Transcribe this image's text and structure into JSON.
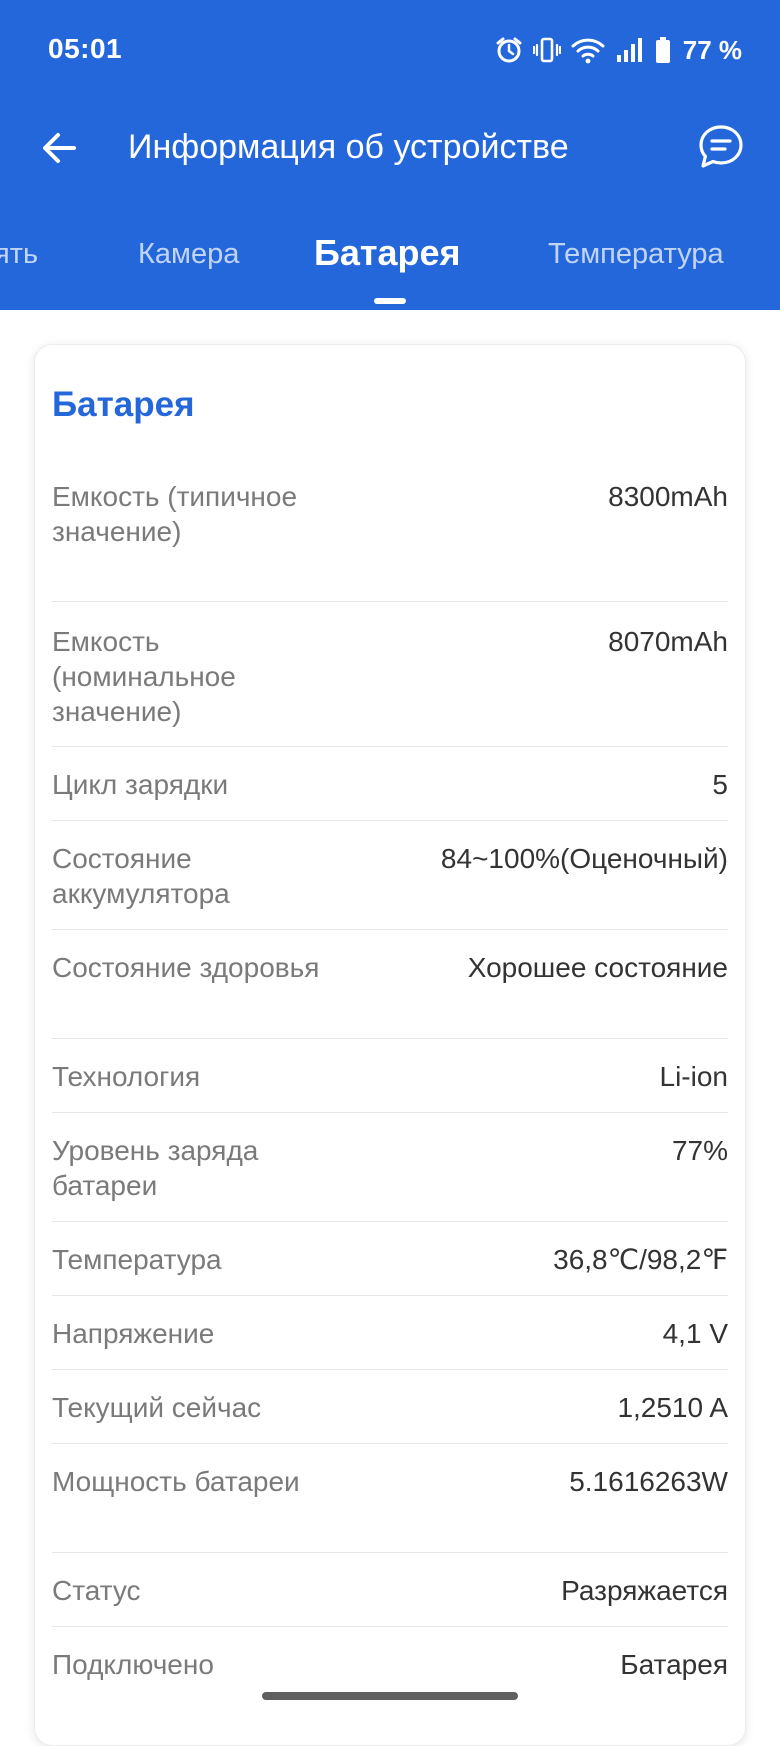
{
  "status_bar": {
    "time": "05:01",
    "battery_percent": "77 %",
    "icons": [
      "alarm-icon",
      "vibrate-icon",
      "wifi-icon",
      "signal-icon",
      "battery-icon"
    ]
  },
  "appbar": {
    "title": "Информация об устройстве",
    "back_icon": "arrow-left-icon",
    "chat_icon": "chat-bubble-icon"
  },
  "tabs": [
    {
      "label": "Память",
      "visible_text": "ять",
      "active": false
    },
    {
      "label": "Камера",
      "active": false
    },
    {
      "label": "Батарея",
      "active": true
    },
    {
      "label": "Температура",
      "active": false
    }
  ],
  "card": {
    "title": "Батарея",
    "rows": [
      {
        "label": "Емкость (типичное значение)",
        "value": "8300mAh"
      },
      {
        "label": "Емкость (номинальное значение)",
        "value": "8070mAh"
      },
      {
        "label": "Цикл зарядки",
        "value": "5"
      },
      {
        "label": "Состояние аккумулятора",
        "value": "84~100%(Оценочный)"
      },
      {
        "label": "Состояние здоровья",
        "value": "Хорошее состояние"
      },
      {
        "label": "Технология",
        "value": "Li-ion"
      },
      {
        "label": "Уровень заряда батареи",
        "value": "77%"
      },
      {
        "label": "Температура",
        "value": "36,8℃/98,2℉"
      },
      {
        "label": "Напряжение",
        "value": "4,1 V"
      },
      {
        "label": "Текущий сейчас",
        "value": "1,2510 A"
      },
      {
        "label": "Мощность батареи",
        "value": "5.1616263W"
      },
      {
        "label": "Статус",
        "value": "Разряжается"
      },
      {
        "label": "Подключено",
        "value": "Батарея"
      }
    ]
  },
  "colors": {
    "primary": "#2467db",
    "label_text": "#7a7a7a",
    "value_text": "#333333",
    "divider": "#e6e6e6"
  }
}
